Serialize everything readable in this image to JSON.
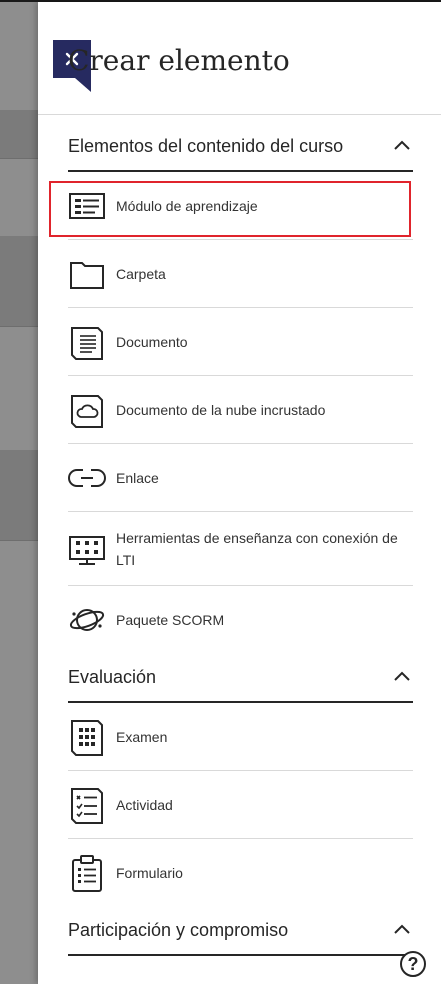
{
  "panel": {
    "title": "Crear elemento",
    "close_icon": "close-icon"
  },
  "sections": [
    {
      "title": "Elementos del contenido del curso",
      "expanded": true,
      "items": [
        {
          "label": "Módulo de aprendizaje",
          "icon": "learning-module-icon",
          "highlighted": true
        },
        {
          "label": "Carpeta",
          "icon": "folder-icon"
        },
        {
          "label": "Documento",
          "icon": "document-icon"
        },
        {
          "label": "Documento de la nube incrustado",
          "icon": "cloud-document-icon"
        },
        {
          "label": "Enlace",
          "icon": "link-icon"
        },
        {
          "label": "Herramientas de enseñanza con conexión de LTI",
          "icon": "lti-tool-icon"
        },
        {
          "label": "Paquete SCORM",
          "icon": "scorm-package-icon"
        }
      ]
    },
    {
      "title": "Evaluación",
      "expanded": true,
      "items": [
        {
          "label": "Examen",
          "icon": "test-icon"
        },
        {
          "label": "Actividad",
          "icon": "assignment-icon"
        },
        {
          "label": "Formulario",
          "icon": "form-icon"
        }
      ]
    },
    {
      "title": "Participación y compromiso",
      "expanded": true,
      "items": []
    }
  ],
  "help": {
    "label": "?",
    "icon": "help-icon"
  },
  "colors": {
    "close_bg": "#262a60",
    "highlight": "#e0242c",
    "text": "#262626",
    "divider": "#d9d9d9"
  }
}
